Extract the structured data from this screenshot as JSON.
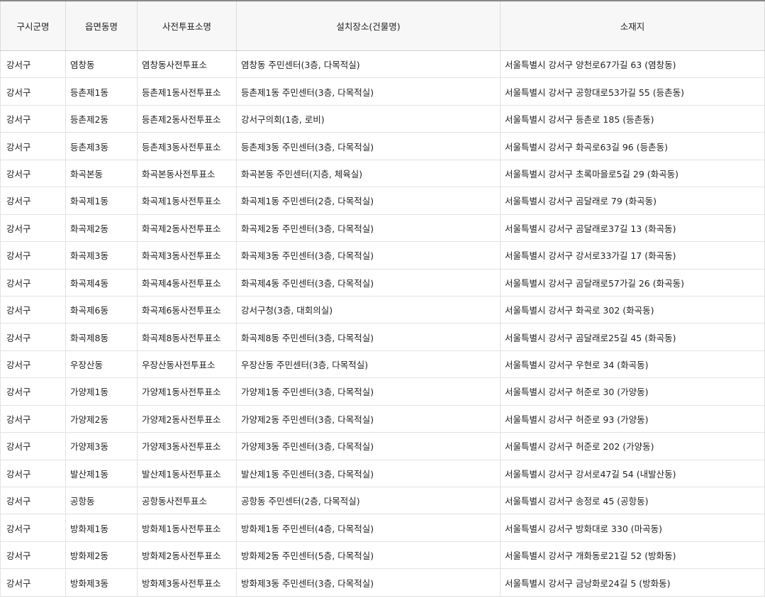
{
  "table": {
    "headers": [
      "구시군명",
      "읍면동명",
      "사전투표소명",
      "설치장소(건물명)",
      "소재지"
    ],
    "rows": [
      [
        "강서구",
        "염창동",
        "염창동사전투표소",
        "염창동 주민센터(3층, 다목적실)",
        "서울특별시 강서구 양천로67가길 63 (염창동)"
      ],
      [
        "강서구",
        "등촌제1동",
        "등촌제1동사전투표소",
        "등촌제1동 주민센터(3층, 다목적실)",
        "서울특별시 강서구 공항대로53가길 55 (등촌동)"
      ],
      [
        "강서구",
        "등촌제2동",
        "등촌제2동사전투표소",
        "강서구의회(1층, 로비)",
        "서울특별시 강서구 등촌로 185 (등촌동)"
      ],
      [
        "강서구",
        "등촌제3동",
        "등촌제3동사전투표소",
        "등촌제3동 주민센터(3층, 다목적실)",
        "서울특별시 강서구 화곡로63길 96 (등촌동)"
      ],
      [
        "강서구",
        "화곡본동",
        "화곡본동사전투표소",
        "화곡본동 주민센터(지층, 체육실)",
        "서울특별시 강서구 초록마을로5길 29 (화곡동)"
      ],
      [
        "강서구",
        "화곡제1동",
        "화곡제1동사전투표소",
        "화곡제1동 주민센터(2층, 다목적실)",
        "서울특별시 강서구 곰달래로 79 (화곡동)"
      ],
      [
        "강서구",
        "화곡제2동",
        "화곡제2동사전투표소",
        "화곡제2동 주민센터(3층, 다목적실)",
        "서울특별시 강서구 곰달래로37길 13 (화곡동)"
      ],
      [
        "강서구",
        "화곡제3동",
        "화곡제3동사전투표소",
        "화곡제3동 주민센터(3층, 다목적실)",
        "서울특별시 강서구 강서로33가길 17 (화곡동)"
      ],
      [
        "강서구",
        "화곡제4동",
        "화곡제4동사전투표소",
        "화곡제4동 주민센터(3층, 다목적실)",
        "서울특별시 강서구 곰달래로57가길 26 (화곡동)"
      ],
      [
        "강서구",
        "화곡제6동",
        "화곡제6동사전투표소",
        "강서구청(3층, 대회의실)",
        "서울특별시 강서구 화곡로 302 (화곡동)"
      ],
      [
        "강서구",
        "화곡제8동",
        "화곡제8동사전투표소",
        "화곡제8동 주민센터(3층, 다목적실)",
        "서울특별시 강서구 곰달래로25길 45 (화곡동)"
      ],
      [
        "강서구",
        "우장산동",
        "우장산동사전투표소",
        "우장산동 주민센터(3층, 다목적실)",
        "서울특별시 강서구 우현로 34 (화곡동)"
      ],
      [
        "강서구",
        "가양제1동",
        "가양제1동사전투표소",
        "가양제1동 주민센터(3층, 다목적실)",
        "서울특별시 강서구 허준로 30 (가양동)"
      ],
      [
        "강서구",
        "가양제2동",
        "가양제2동사전투표소",
        "가양제2동 주민센터(3층, 다목적실)",
        "서울특별시 강서구 허준로 93 (가양동)"
      ],
      [
        "강서구",
        "가양제3동",
        "가양제3동사전투표소",
        "가양제3동 주민센터(3층, 다목적실)",
        "서울특별시 강서구 허준로 202 (가양동)"
      ],
      [
        "강서구",
        "발산제1동",
        "발산제1동사전투표소",
        "발산제1동 주민센터(3층, 다목적실)",
        "서울특별시 강서구 강서로47길 54 (내발산동)"
      ],
      [
        "강서구",
        "공항동",
        "공항동사전투표소",
        "공항동 주민센터(2층, 다목적실)",
        "서울특별시 강서구 송정로 45 (공항동)"
      ],
      [
        "강서구",
        "방화제1동",
        "방화제1동사전투표소",
        "방화제1동 주민센터(4층, 다목적실)",
        "서울특별시 강서구 방화대로 330 (마곡동)"
      ],
      [
        "강서구",
        "방화제2동",
        "방화제2동사전투표소",
        "방화제2동 주민센터(5층, 다목적실)",
        "서울특별시 강서구 개화동로21길 52 (방화동)"
      ],
      [
        "강서구",
        "방화제3동",
        "방화제3동사전투표소",
        "방화제3동 주민센터(3층, 다목적실)",
        "서울특별시 강서구 금낭화로24길 5 (방화동)"
      ]
    ]
  }
}
